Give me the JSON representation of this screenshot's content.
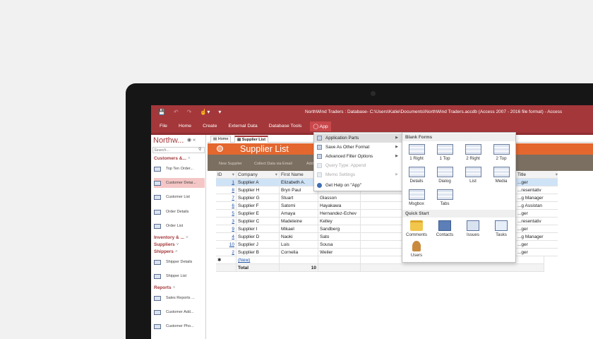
{
  "window": {
    "title": "NorthWind Traders : Database- C:\\Users\\Katie\\Documents\\NorthWind Traders.accdb (Access 2007 - 2016 file format) - Access"
  },
  "ribbon": {
    "tabs": [
      "File",
      "Home",
      "Create",
      "External Data",
      "Database Tools"
    ],
    "app_tab": "App"
  },
  "nav": {
    "title": "Northw...",
    "search_placeholder": "Search...",
    "groups": {
      "customers": "Customers &...",
      "inventory": "Inventory & ...",
      "suppliers": "Suppliers",
      "shippers": "Shippers",
      "reports": "Reports"
    },
    "items": [
      "Top Ten Order...",
      "Customer Detai...",
      "Customer List",
      "Order Details",
      "Order List",
      "Shipper Details",
      "Shipper List",
      "Sales Reports ...",
      "Customer Add...",
      "Customer Pho..."
    ]
  },
  "document": {
    "tabs": [
      "Home",
      "Supplier List"
    ],
    "form_title": "Supplier List",
    "commands": [
      "New Supplier",
      "Collect Data via Email",
      "Add"
    ]
  },
  "grid": {
    "headers": [
      "ID",
      "Company",
      "First Name",
      "Last Name",
      "Title"
    ],
    "rows": [
      {
        "id": "1",
        "company": "Supplier A",
        "first": "Elizabeth A.",
        "last": "",
        "title": "...ger"
      },
      {
        "id": "8",
        "company": "Supplier H",
        "first": "Bryn Paul",
        "last": "Dunton",
        "title": "...resentativ"
      },
      {
        "id": "7",
        "company": "Supplier G",
        "first": "Stuart",
        "last": "Glasson",
        "title": "...g Manager"
      },
      {
        "id": "6",
        "company": "Supplier F",
        "first": "Satomi",
        "last": "Hayakawa",
        "title": "...g Assistan"
      },
      {
        "id": "5",
        "company": "Supplier E",
        "first": "Amaya",
        "last": "Hernandez-Echev",
        "title": "...ger"
      },
      {
        "id": "3",
        "company": "Supplier C",
        "first": "Madeleine",
        "last": "Kelley",
        "title": "...resentativ"
      },
      {
        "id": "9",
        "company": "Supplier I",
        "first": "Mikael",
        "last": "Sandberg",
        "title": "...ger"
      },
      {
        "id": "4",
        "company": "Supplier D",
        "first": "Naoki",
        "last": "Sato",
        "title": "...g Manager"
      },
      {
        "id": "10",
        "company": "Supplier J",
        "first": "Luis",
        "last": "Sousa",
        "title": "...ger"
      },
      {
        "id": "2",
        "company": "Supplier B",
        "first": "Cornelia",
        "last": "Weiler",
        "title": "...ger"
      }
    ],
    "new_row": "(New)",
    "total_label": "Total",
    "total_value": "10"
  },
  "app_menu": {
    "items": [
      "Application Parts",
      "Save As Other Format",
      "Advanced Filter Options",
      "Query Type: Append",
      "Memo Settings",
      "Get Help on \"App\""
    ]
  },
  "gallery": {
    "blank_forms_title": "Blank Forms",
    "blank_forms": [
      "1 Right",
      "1 Top",
      "2 Right",
      "2 Top",
      "Details",
      "Dialog",
      "List",
      "Media",
      "Msgbox",
      "Tabs"
    ],
    "quick_start_title": "Quick Start",
    "quick_start": [
      "Comments",
      "Contacts",
      "Issues",
      "Tasks",
      "Users"
    ]
  }
}
